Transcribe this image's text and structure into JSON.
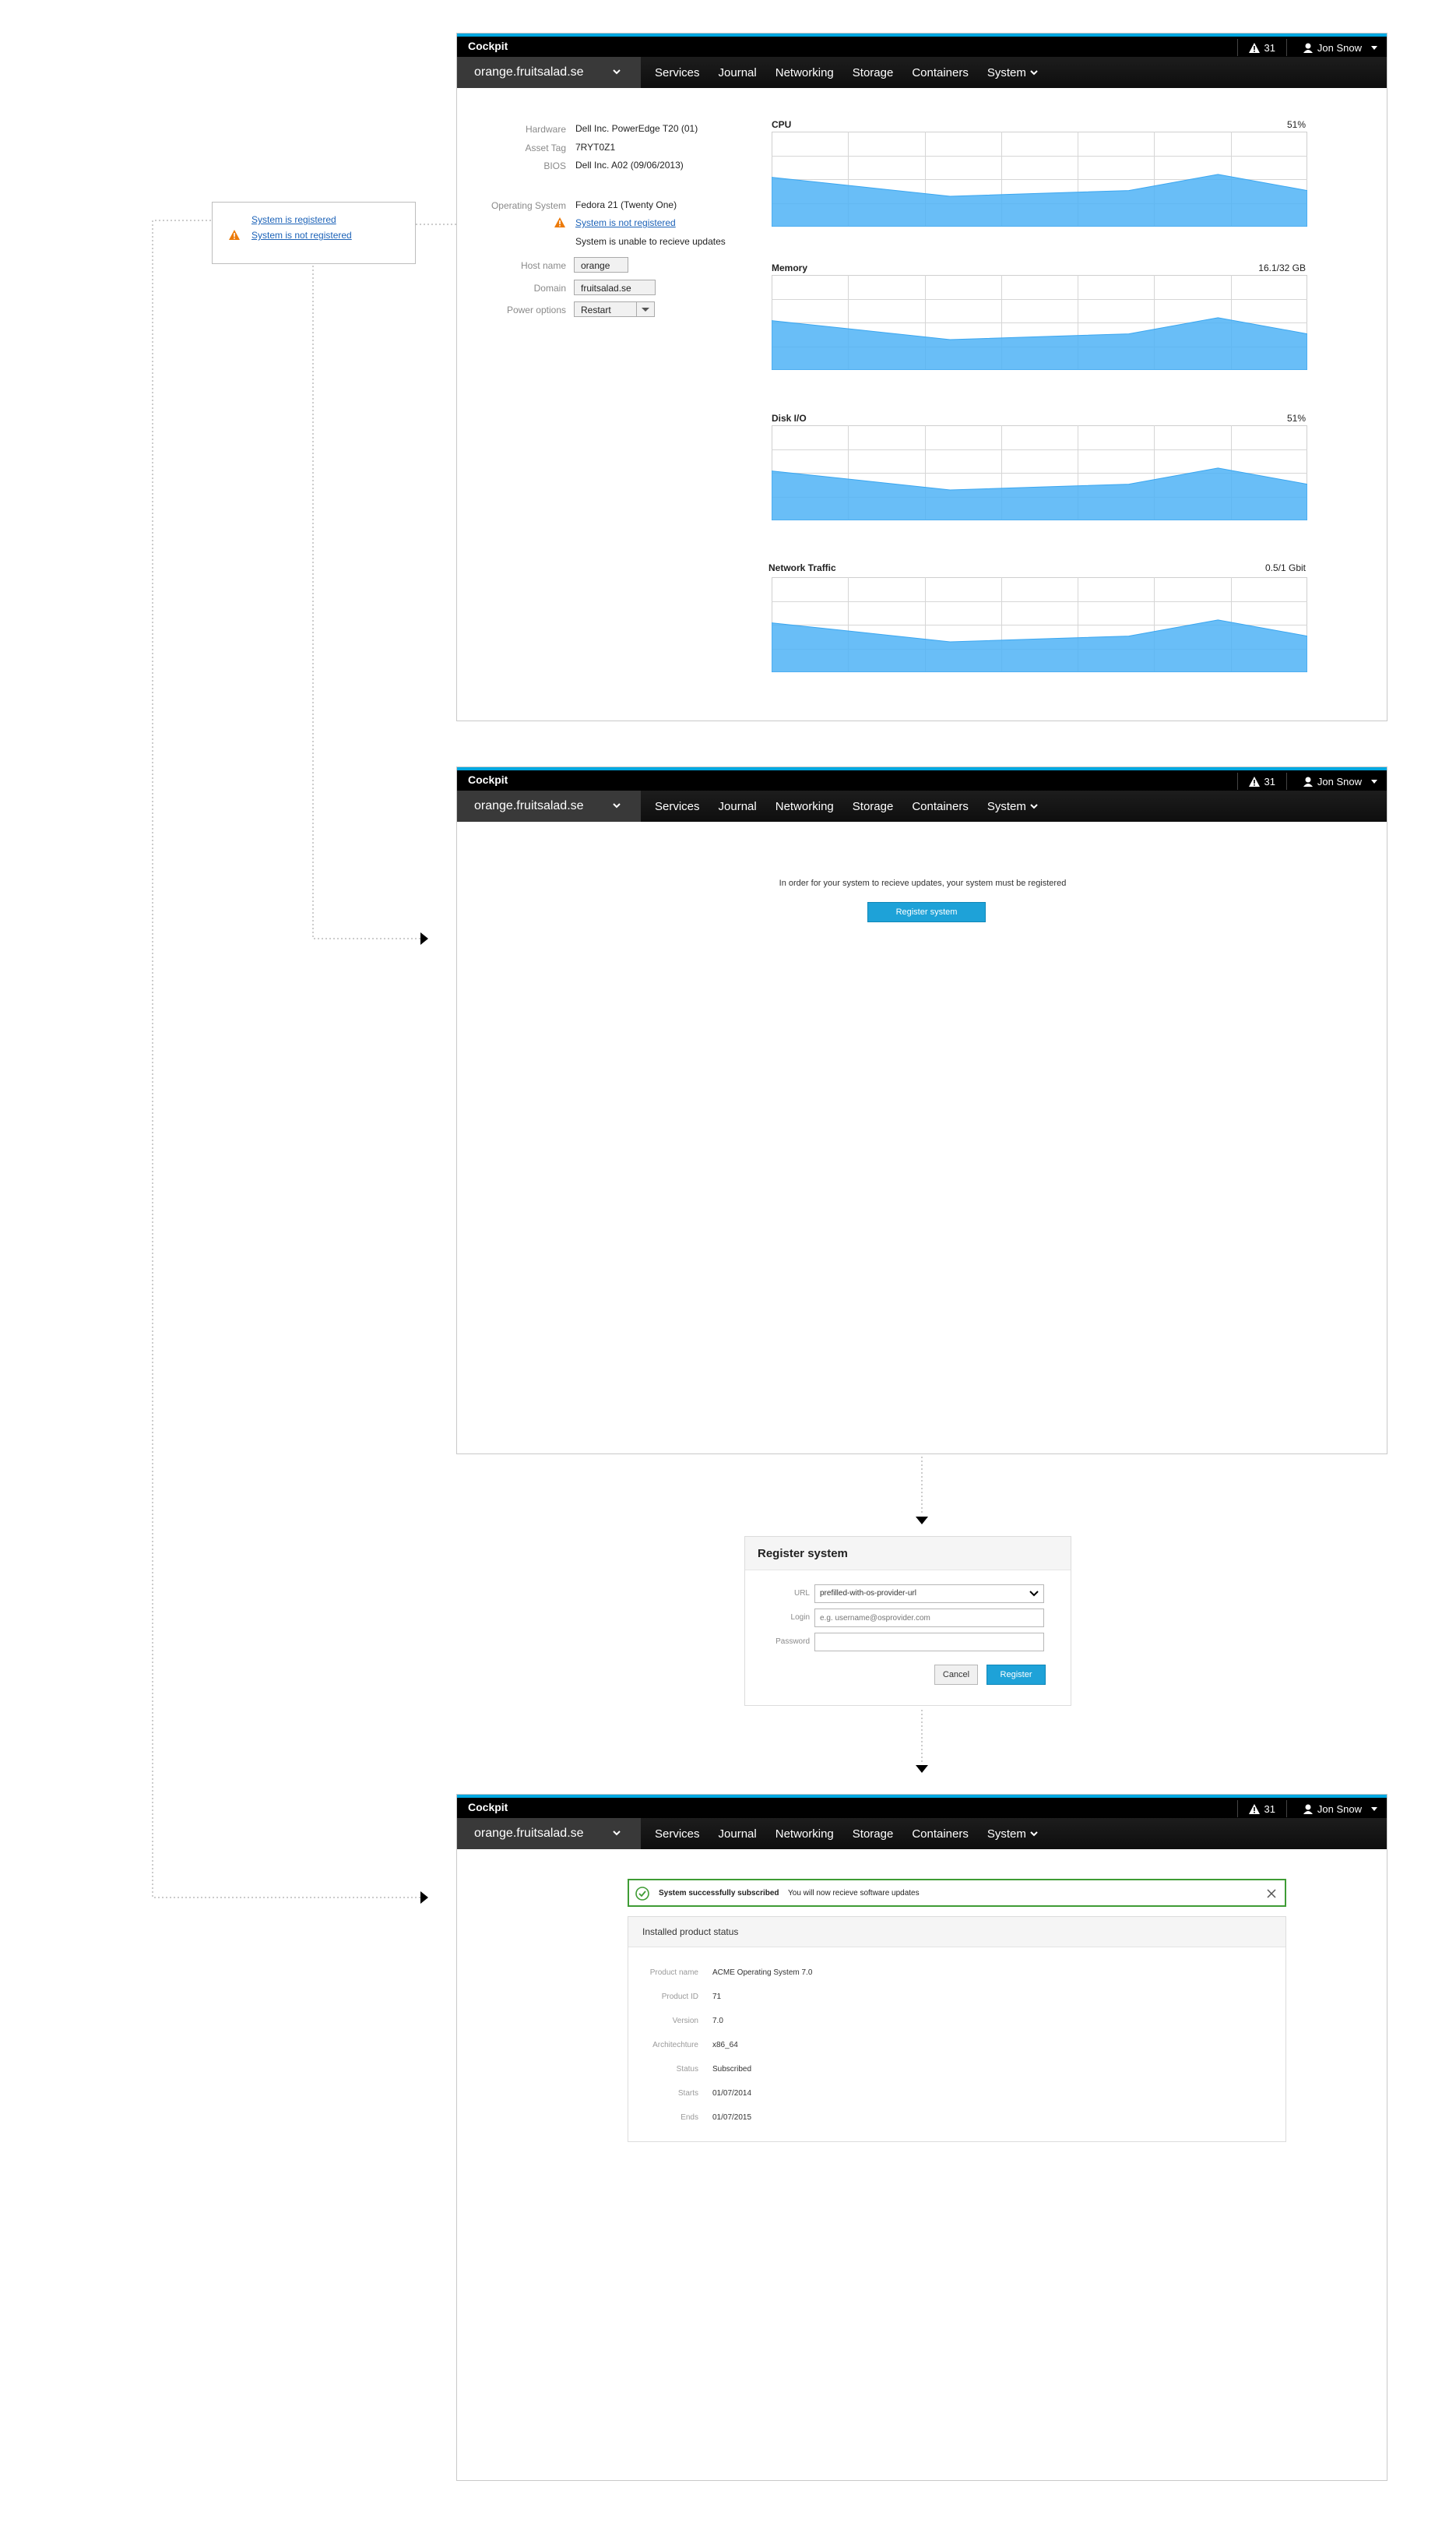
{
  "cockpit": {
    "brand": "Cockpit",
    "alert_count": "31",
    "user": "Jon Snow",
    "host": "orange.fruitsalad.se",
    "nav": [
      "Services",
      "Journal",
      "Networking",
      "Storage",
      "Containers",
      "System"
    ]
  },
  "popup": {
    "registered": "System is registered",
    "not_registered": "System is not registered"
  },
  "info": {
    "hardware_label": "Hardware",
    "hardware": "Dell Inc. PowerEdge T20 (01)",
    "asset_label": "Asset Tag",
    "asset": "7RYT0Z1",
    "bios_label": "BIOS",
    "bios": "Dell Inc. A02 (09/06/2013)",
    "os_label": "Operating System",
    "os": "Fedora 21 (Twenty One)",
    "reg_link": "System is not registered",
    "reg_note": "System is unable to recieve updates",
    "hostname_label": "Host name",
    "hostname": "orange",
    "domain_label": "Domain",
    "domain": "fruitsalad.se",
    "power_label": "Power options",
    "power": "Restart"
  },
  "charts": {
    "cpu_title": "CPU",
    "cpu_value": "51%",
    "memory_title": "Memory",
    "memory_value": "16.1/32 GB",
    "disk_title": "Disk I/O",
    "disk_value": "51%",
    "net_title": "Network Traffic",
    "net_value": "0.5/1 Gbit"
  },
  "chart_data": [
    {
      "type": "area",
      "title": "CPU",
      "values": [
        0.52,
        0.42,
        0.32,
        0.35,
        0.38,
        0.55,
        0.38
      ],
      "ylim": [
        0,
        1
      ],
      "grid": true
    },
    {
      "type": "area",
      "title": "Memory",
      "values": [
        0.52,
        0.42,
        0.32,
        0.35,
        0.38,
        0.55,
        0.38
      ],
      "ylim": [
        0,
        1
      ],
      "grid": true
    },
    {
      "type": "area",
      "title": "Disk I/O",
      "values": [
        0.52,
        0.42,
        0.32,
        0.35,
        0.38,
        0.55,
        0.38
      ],
      "ylim": [
        0,
        1
      ],
      "grid": true
    },
    {
      "type": "area",
      "title": "Network Traffic",
      "values": [
        0.52,
        0.42,
        0.32,
        0.35,
        0.38,
        0.55,
        0.38
      ],
      "ylim": [
        0,
        1
      ],
      "grid": true
    }
  ],
  "register_page": {
    "prompt": "In order for your system to recieve updates, your system must be registered",
    "button": "Register system"
  },
  "dialog": {
    "title": "Register system",
    "url_label": "URL",
    "url_value": "prefilled-with-os-provider-url",
    "login_label": "Login",
    "login_placeholder": "e.g. username@osprovider.com",
    "password_label": "Password",
    "cancel": "Cancel",
    "register": "Register"
  },
  "subscribed": {
    "alert_bold": "System successfully subscribed",
    "alert_text": "You will now recieve software updates",
    "panel_title": "Installed product status",
    "rows": [
      {
        "label": "Product name",
        "value": "ACME Operating System 7.0"
      },
      {
        "label": "Product ID",
        "value": "71"
      },
      {
        "label": "Version",
        "value": "7.0"
      },
      {
        "label": "Architechture",
        "value": "x86_64"
      },
      {
        "label": "Status",
        "value": "Subscribed"
      },
      {
        "label": "Starts",
        "value": "01/07/2014"
      },
      {
        "label": "Ends",
        "value": "01/07/2015"
      }
    ]
  },
  "colors": {
    "accent": "#00a8e1",
    "chart_fill": "#4fb3f6",
    "link": "#1d63b8",
    "warning": "#ec7a08",
    "success": "#3f9c35"
  }
}
